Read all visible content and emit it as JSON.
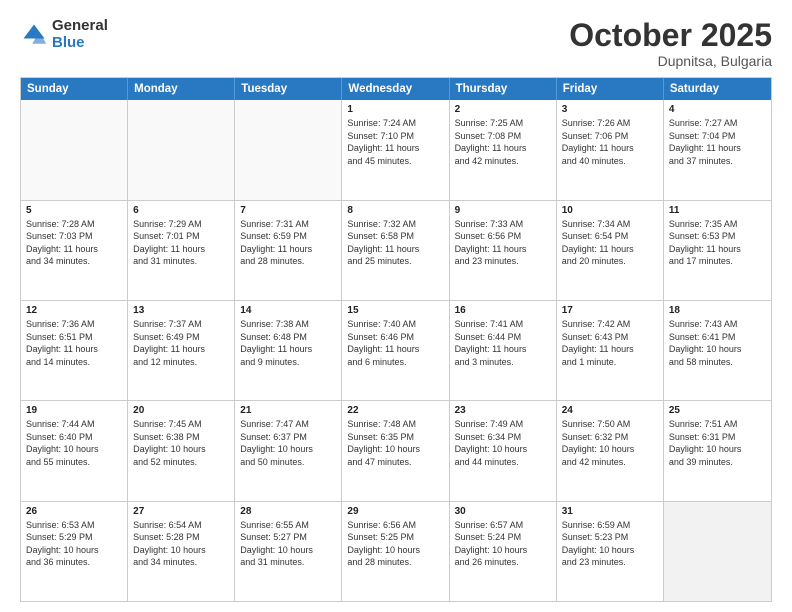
{
  "header": {
    "logo_general": "General",
    "logo_blue": "Blue",
    "month_title": "October 2025",
    "location": "Dupnitsa, Bulgaria"
  },
  "weekdays": [
    "Sunday",
    "Monday",
    "Tuesday",
    "Wednesday",
    "Thursday",
    "Friday",
    "Saturday"
  ],
  "rows": [
    [
      {
        "day": "",
        "lines": []
      },
      {
        "day": "",
        "lines": []
      },
      {
        "day": "",
        "lines": []
      },
      {
        "day": "1",
        "lines": [
          "Sunrise: 7:24 AM",
          "Sunset: 7:10 PM",
          "Daylight: 11 hours",
          "and 45 minutes."
        ]
      },
      {
        "day": "2",
        "lines": [
          "Sunrise: 7:25 AM",
          "Sunset: 7:08 PM",
          "Daylight: 11 hours",
          "and 42 minutes."
        ]
      },
      {
        "day": "3",
        "lines": [
          "Sunrise: 7:26 AM",
          "Sunset: 7:06 PM",
          "Daylight: 11 hours",
          "and 40 minutes."
        ]
      },
      {
        "day": "4",
        "lines": [
          "Sunrise: 7:27 AM",
          "Sunset: 7:04 PM",
          "Daylight: 11 hours",
          "and 37 minutes."
        ]
      }
    ],
    [
      {
        "day": "5",
        "lines": [
          "Sunrise: 7:28 AM",
          "Sunset: 7:03 PM",
          "Daylight: 11 hours",
          "and 34 minutes."
        ]
      },
      {
        "day": "6",
        "lines": [
          "Sunrise: 7:29 AM",
          "Sunset: 7:01 PM",
          "Daylight: 11 hours",
          "and 31 minutes."
        ]
      },
      {
        "day": "7",
        "lines": [
          "Sunrise: 7:31 AM",
          "Sunset: 6:59 PM",
          "Daylight: 11 hours",
          "and 28 minutes."
        ]
      },
      {
        "day": "8",
        "lines": [
          "Sunrise: 7:32 AM",
          "Sunset: 6:58 PM",
          "Daylight: 11 hours",
          "and 25 minutes."
        ]
      },
      {
        "day": "9",
        "lines": [
          "Sunrise: 7:33 AM",
          "Sunset: 6:56 PM",
          "Daylight: 11 hours",
          "and 23 minutes."
        ]
      },
      {
        "day": "10",
        "lines": [
          "Sunrise: 7:34 AM",
          "Sunset: 6:54 PM",
          "Daylight: 11 hours",
          "and 20 minutes."
        ]
      },
      {
        "day": "11",
        "lines": [
          "Sunrise: 7:35 AM",
          "Sunset: 6:53 PM",
          "Daylight: 11 hours",
          "and 17 minutes."
        ]
      }
    ],
    [
      {
        "day": "12",
        "lines": [
          "Sunrise: 7:36 AM",
          "Sunset: 6:51 PM",
          "Daylight: 11 hours",
          "and 14 minutes."
        ]
      },
      {
        "day": "13",
        "lines": [
          "Sunrise: 7:37 AM",
          "Sunset: 6:49 PM",
          "Daylight: 11 hours",
          "and 12 minutes."
        ]
      },
      {
        "day": "14",
        "lines": [
          "Sunrise: 7:38 AM",
          "Sunset: 6:48 PM",
          "Daylight: 11 hours",
          "and 9 minutes."
        ]
      },
      {
        "day": "15",
        "lines": [
          "Sunrise: 7:40 AM",
          "Sunset: 6:46 PM",
          "Daylight: 11 hours",
          "and 6 minutes."
        ]
      },
      {
        "day": "16",
        "lines": [
          "Sunrise: 7:41 AM",
          "Sunset: 6:44 PM",
          "Daylight: 11 hours",
          "and 3 minutes."
        ]
      },
      {
        "day": "17",
        "lines": [
          "Sunrise: 7:42 AM",
          "Sunset: 6:43 PM",
          "Daylight: 11 hours",
          "and 1 minute."
        ]
      },
      {
        "day": "18",
        "lines": [
          "Sunrise: 7:43 AM",
          "Sunset: 6:41 PM",
          "Daylight: 10 hours",
          "and 58 minutes."
        ]
      }
    ],
    [
      {
        "day": "19",
        "lines": [
          "Sunrise: 7:44 AM",
          "Sunset: 6:40 PM",
          "Daylight: 10 hours",
          "and 55 minutes."
        ]
      },
      {
        "day": "20",
        "lines": [
          "Sunrise: 7:45 AM",
          "Sunset: 6:38 PM",
          "Daylight: 10 hours",
          "and 52 minutes."
        ]
      },
      {
        "day": "21",
        "lines": [
          "Sunrise: 7:47 AM",
          "Sunset: 6:37 PM",
          "Daylight: 10 hours",
          "and 50 minutes."
        ]
      },
      {
        "day": "22",
        "lines": [
          "Sunrise: 7:48 AM",
          "Sunset: 6:35 PM",
          "Daylight: 10 hours",
          "and 47 minutes."
        ]
      },
      {
        "day": "23",
        "lines": [
          "Sunrise: 7:49 AM",
          "Sunset: 6:34 PM",
          "Daylight: 10 hours",
          "and 44 minutes."
        ]
      },
      {
        "day": "24",
        "lines": [
          "Sunrise: 7:50 AM",
          "Sunset: 6:32 PM",
          "Daylight: 10 hours",
          "and 42 minutes."
        ]
      },
      {
        "day": "25",
        "lines": [
          "Sunrise: 7:51 AM",
          "Sunset: 6:31 PM",
          "Daylight: 10 hours",
          "and 39 minutes."
        ]
      }
    ],
    [
      {
        "day": "26",
        "lines": [
          "Sunrise: 6:53 AM",
          "Sunset: 5:29 PM",
          "Daylight: 10 hours",
          "and 36 minutes."
        ]
      },
      {
        "day": "27",
        "lines": [
          "Sunrise: 6:54 AM",
          "Sunset: 5:28 PM",
          "Daylight: 10 hours",
          "and 34 minutes."
        ]
      },
      {
        "day": "28",
        "lines": [
          "Sunrise: 6:55 AM",
          "Sunset: 5:27 PM",
          "Daylight: 10 hours",
          "and 31 minutes."
        ]
      },
      {
        "day": "29",
        "lines": [
          "Sunrise: 6:56 AM",
          "Sunset: 5:25 PM",
          "Daylight: 10 hours",
          "and 28 minutes."
        ]
      },
      {
        "day": "30",
        "lines": [
          "Sunrise: 6:57 AM",
          "Sunset: 5:24 PM",
          "Daylight: 10 hours",
          "and 26 minutes."
        ]
      },
      {
        "day": "31",
        "lines": [
          "Sunrise: 6:59 AM",
          "Sunset: 5:23 PM",
          "Daylight: 10 hours",
          "and 23 minutes."
        ]
      },
      {
        "day": "",
        "lines": []
      }
    ]
  ]
}
